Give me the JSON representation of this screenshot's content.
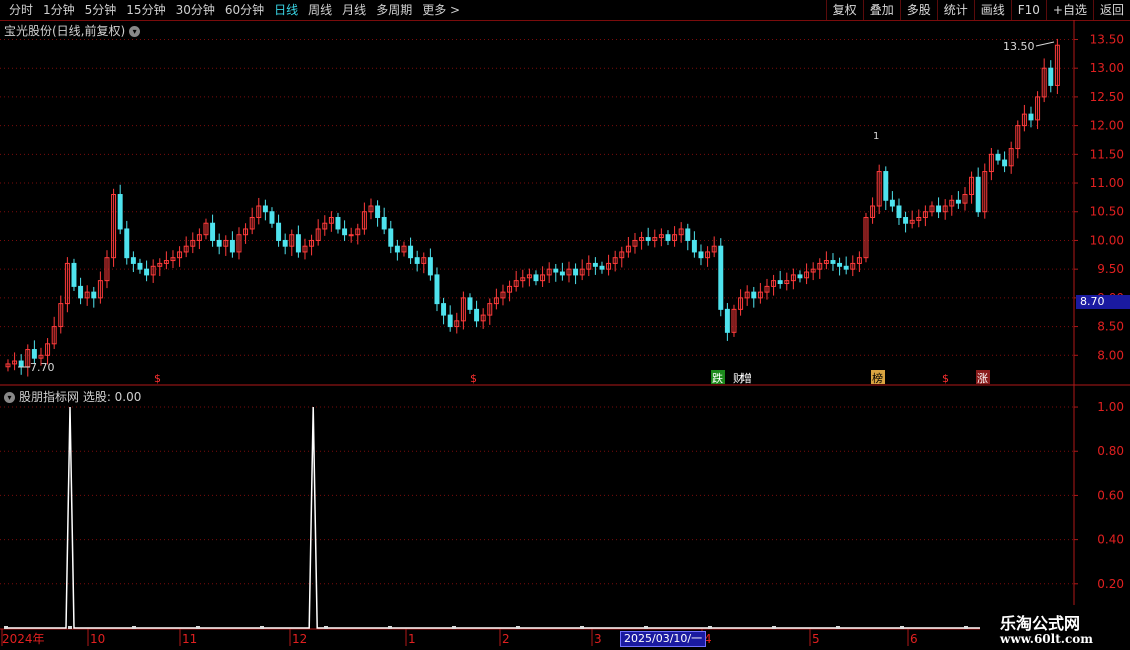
{
  "toolbar": {
    "tabs": [
      "分时",
      "1分钟",
      "5分钟",
      "15分钟",
      "30分钟",
      "60分钟",
      "日线",
      "周线",
      "月线",
      "多周期",
      "更多 >"
    ],
    "active_tab": "日线",
    "buttons": [
      "复权",
      "叠加",
      "多股",
      "统计",
      "画线",
      "F10",
      "+自选",
      "返回"
    ]
  },
  "main": {
    "title": "宝光股份(日线,前复权)",
    "high_label": "13.50",
    "low_label": "7.70",
    "current_price": "8.70",
    "marker_1": "1",
    "tags": [
      "$",
      "$",
      "跌",
      "财",
      "增",
      "榜",
      "$",
      "涨"
    ]
  },
  "indicator": {
    "title": "股朋指标网  选股: 0.00"
  },
  "date_axis": {
    "labels": [
      "2024年",
      "10",
      "11",
      "12",
      "1",
      "2",
      "3",
      "4",
      "5",
      "6"
    ],
    "highlight": "2025/03/10/一"
  },
  "watermark": {
    "line1": "乐淘公式网",
    "line2": "www.60lt.com"
  },
  "colors": {
    "up": "#ff3b3b",
    "down": "#4fe3ee",
    "grid": "#7a0c0c",
    "axis": "#b01818"
  },
  "chart_data": [
    {
      "type": "candlestick",
      "ylim": [
        7.5,
        13.7
      ],
      "y_ticks": [
        8.0,
        8.5,
        9.0,
        9.5,
        10.0,
        10.5,
        11.0,
        11.5,
        12.0,
        12.5,
        13.0,
        13.5
      ],
      "closes": [
        7.85,
        7.9,
        7.8,
        8.1,
        7.95,
        8.0,
        8.2,
        8.5,
        8.9,
        9.6,
        9.2,
        9.0,
        9.1,
        9.0,
        9.3,
        9.7,
        10.8,
        10.2,
        9.7,
        9.6,
        9.5,
        9.4,
        9.55,
        9.6,
        9.65,
        9.7,
        9.8,
        9.9,
        10.0,
        10.1,
        10.3,
        10.0,
        9.9,
        10.0,
        9.8,
        10.1,
        10.2,
        10.4,
        10.6,
        10.5,
        10.3,
        10.0,
        9.9,
        10.1,
        9.8,
        9.9,
        10.0,
        10.2,
        10.3,
        10.4,
        10.2,
        10.1,
        10.1,
        10.2,
        10.5,
        10.6,
        10.4,
        10.2,
        9.9,
        9.8,
        9.9,
        9.7,
        9.6,
        9.7,
        9.4,
        8.9,
        8.7,
        8.5,
        8.6,
        9.0,
        8.8,
        8.6,
        8.7,
        8.9,
        9.0,
        9.1,
        9.2,
        9.3,
        9.35,
        9.4,
        9.3,
        9.4,
        9.5,
        9.45,
        9.4,
        9.5,
        9.4,
        9.5,
        9.6,
        9.55,
        9.5,
        9.6,
        9.7,
        9.8,
        9.9,
        10.0,
        10.05,
        10.0,
        10.05,
        10.1,
        10.0,
        10.1,
        10.2,
        10.0,
        9.8,
        9.7,
        9.8,
        9.9,
        8.8,
        8.4,
        8.8,
        9.0,
        9.1,
        9.0,
        9.1,
        9.2,
        9.3,
        9.25,
        9.3,
        9.4,
        9.35,
        9.45,
        9.5,
        9.6,
        9.65,
        9.6,
        9.55,
        9.5,
        9.6,
        9.7,
        10.4,
        10.6,
        11.2,
        10.7,
        10.6,
        10.4,
        10.3,
        10.35,
        10.4,
        10.5,
        10.6,
        10.5,
        10.6,
        10.7,
        10.65,
        10.8,
        11.1,
        10.5,
        11.2,
        11.5,
        11.4,
        11.3,
        11.6,
        12.0,
        12.2,
        12.1,
        12.5,
        13.0,
        12.7,
        13.4
      ]
    },
    {
      "type": "line",
      "name": "选股",
      "ylim": [
        0,
        1.05
      ],
      "y_ticks": [
        0.2,
        0.4,
        0.6,
        0.8,
        1.0
      ],
      "spikes_at": [
        10,
        48
      ],
      "length": 165
    }
  ]
}
